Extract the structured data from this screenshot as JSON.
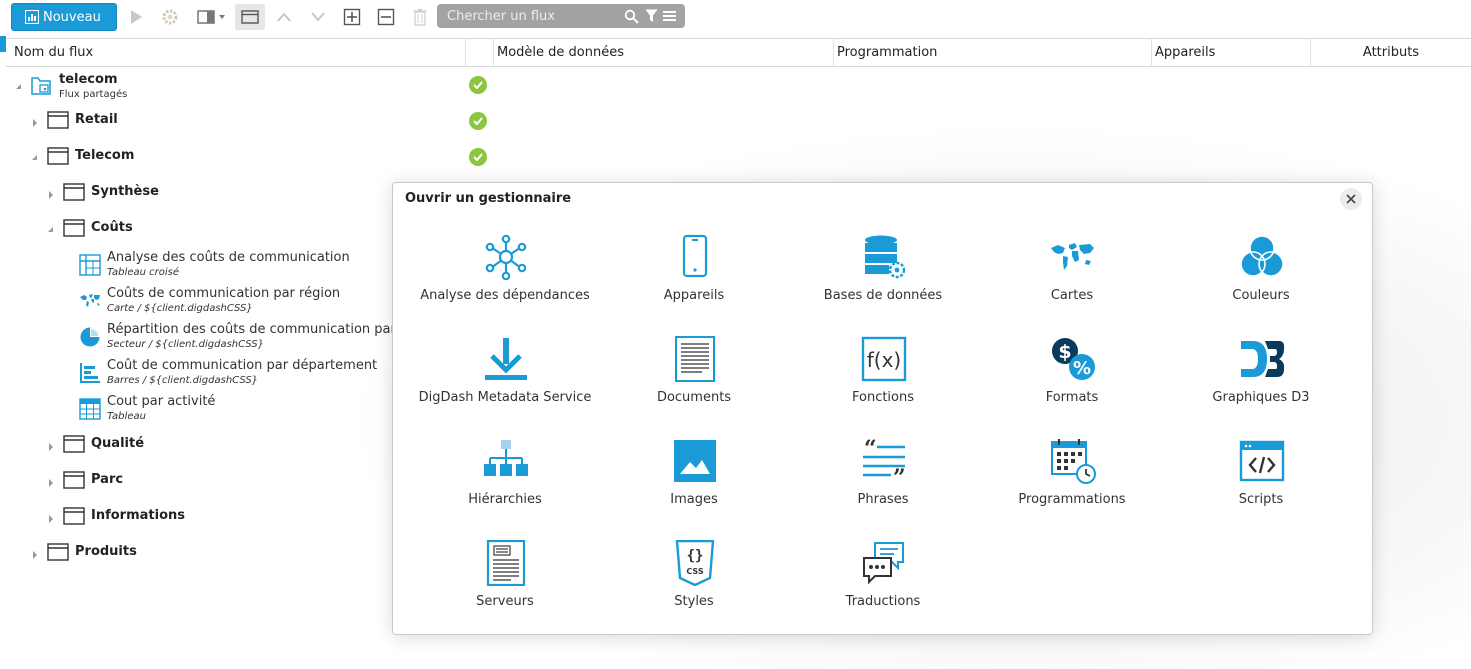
{
  "toolbar": {
    "new_label": "Nouveau",
    "search_placeholder": "Chercher un flux"
  },
  "columns": {
    "name": "Nom du flux",
    "model": "Modèle de données",
    "programmation": "Programmation",
    "devices": "Appareils",
    "attributes": "Attributs"
  },
  "tree": {
    "root": {
      "label": "telecom",
      "sub": "Flux partagés"
    },
    "retail": "Retail",
    "telecom": "Telecom",
    "synthese": "Synthèse",
    "couts": "Coûts",
    "items": [
      {
        "label": "Analyse des coûts de communication",
        "sub": "Tableau croisé",
        "icon": "pivot-table-icon"
      },
      {
        "label": "Coûts de communication par région",
        "sub": "Carte / ${client.digdashCSS}",
        "icon": "world-map-icon"
      },
      {
        "label": "Répartition des coûts de communication par t",
        "sub": "Secteur / ${client.digdashCSS}",
        "icon": "pie-chart-icon"
      },
      {
        "label": "Coût de communication par département",
        "sub": "Barres / ${client.digdashCSS}",
        "icon": "bar-chart-icon"
      },
      {
        "label": "Cout par activité",
        "sub": "Tableau",
        "icon": "table-icon"
      }
    ],
    "qualite": "Qualité",
    "parc": "Parc",
    "informations": "Informations",
    "produits": "Produits"
  },
  "dialog": {
    "title": "Ouvrir un gestionnaire",
    "tiles": [
      {
        "label": "Analyse des dépendances",
        "icon": "network-icon"
      },
      {
        "label": "Appareils",
        "icon": "mobile-device-icon"
      },
      {
        "label": "Bases de données",
        "icon": "database-gear-icon"
      },
      {
        "label": "Cartes",
        "icon": "world-map-icon"
      },
      {
        "label": "Couleurs",
        "icon": "color-circles-icon"
      },
      {
        "label": "DigDash Metadata Service",
        "icon": "download-icon"
      },
      {
        "label": "Documents",
        "icon": "document-icon"
      },
      {
        "label": "Fonctions",
        "icon": "function-icon"
      },
      {
        "label": "Formats",
        "icon": "dollar-percent-icon"
      },
      {
        "label": "Graphiques D3",
        "icon": "d3-icon"
      },
      {
        "label": "Hiérarchies",
        "icon": "hierarchy-icon"
      },
      {
        "label": "Images",
        "icon": "image-icon"
      },
      {
        "label": "Phrases",
        "icon": "quote-icon"
      },
      {
        "label": "Programmations",
        "icon": "calendar-clock-icon"
      },
      {
        "label": "Scripts",
        "icon": "code-window-icon"
      },
      {
        "label": "Serveurs",
        "icon": "server-document-icon"
      },
      {
        "label": "Styles",
        "icon": "css-icon"
      },
      {
        "label": "Traductions",
        "icon": "chat-bubbles-icon"
      }
    ]
  },
  "colors": {
    "accent": "#1a9ad6",
    "check": "#8cc63f",
    "icon_blue": "#1a9ad6"
  }
}
